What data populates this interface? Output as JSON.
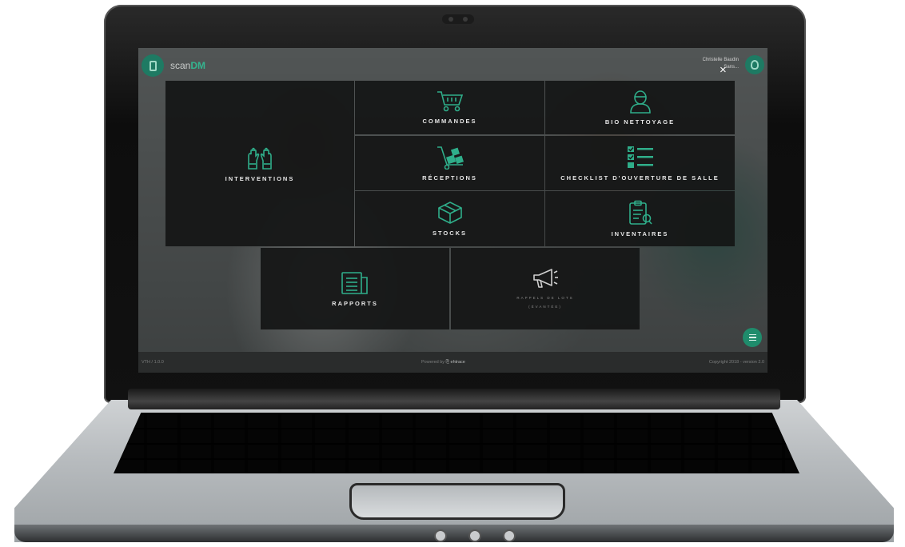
{
  "header": {
    "app_name_prefix": "scan",
    "app_name_suffix": "DM",
    "user_name": "Christelle Baudin",
    "user_role": "Sans..."
  },
  "menu": {
    "close_label": "×",
    "tiles": {
      "interventions": "INTERVENTIONS",
      "commandes": "COMMANDES",
      "bio_nettoyage": "BIO NETTOYAGE",
      "receptions": "RÉCEPTIONS",
      "checklist": "CHECKLIST D'OUVERTURE DE SALLE",
      "stocks": "STOCKS",
      "inventaires": "INVENTAIRES",
      "rapports": "RAPPORTS",
      "rappels_de_lots": "RAPPELS DE LOTS",
      "rappels_status": "(ÉVANTÉE)"
    }
  },
  "footer": {
    "left": "VTH / 1.0.0",
    "powered_by": "Powered by",
    "brand": "ehtrace",
    "copyright": "Copyright 2018 - version 2.0"
  },
  "colors": {
    "accent": "#2fae8a",
    "tile_bg": "#141515",
    "fab": "#1f8c6c"
  }
}
